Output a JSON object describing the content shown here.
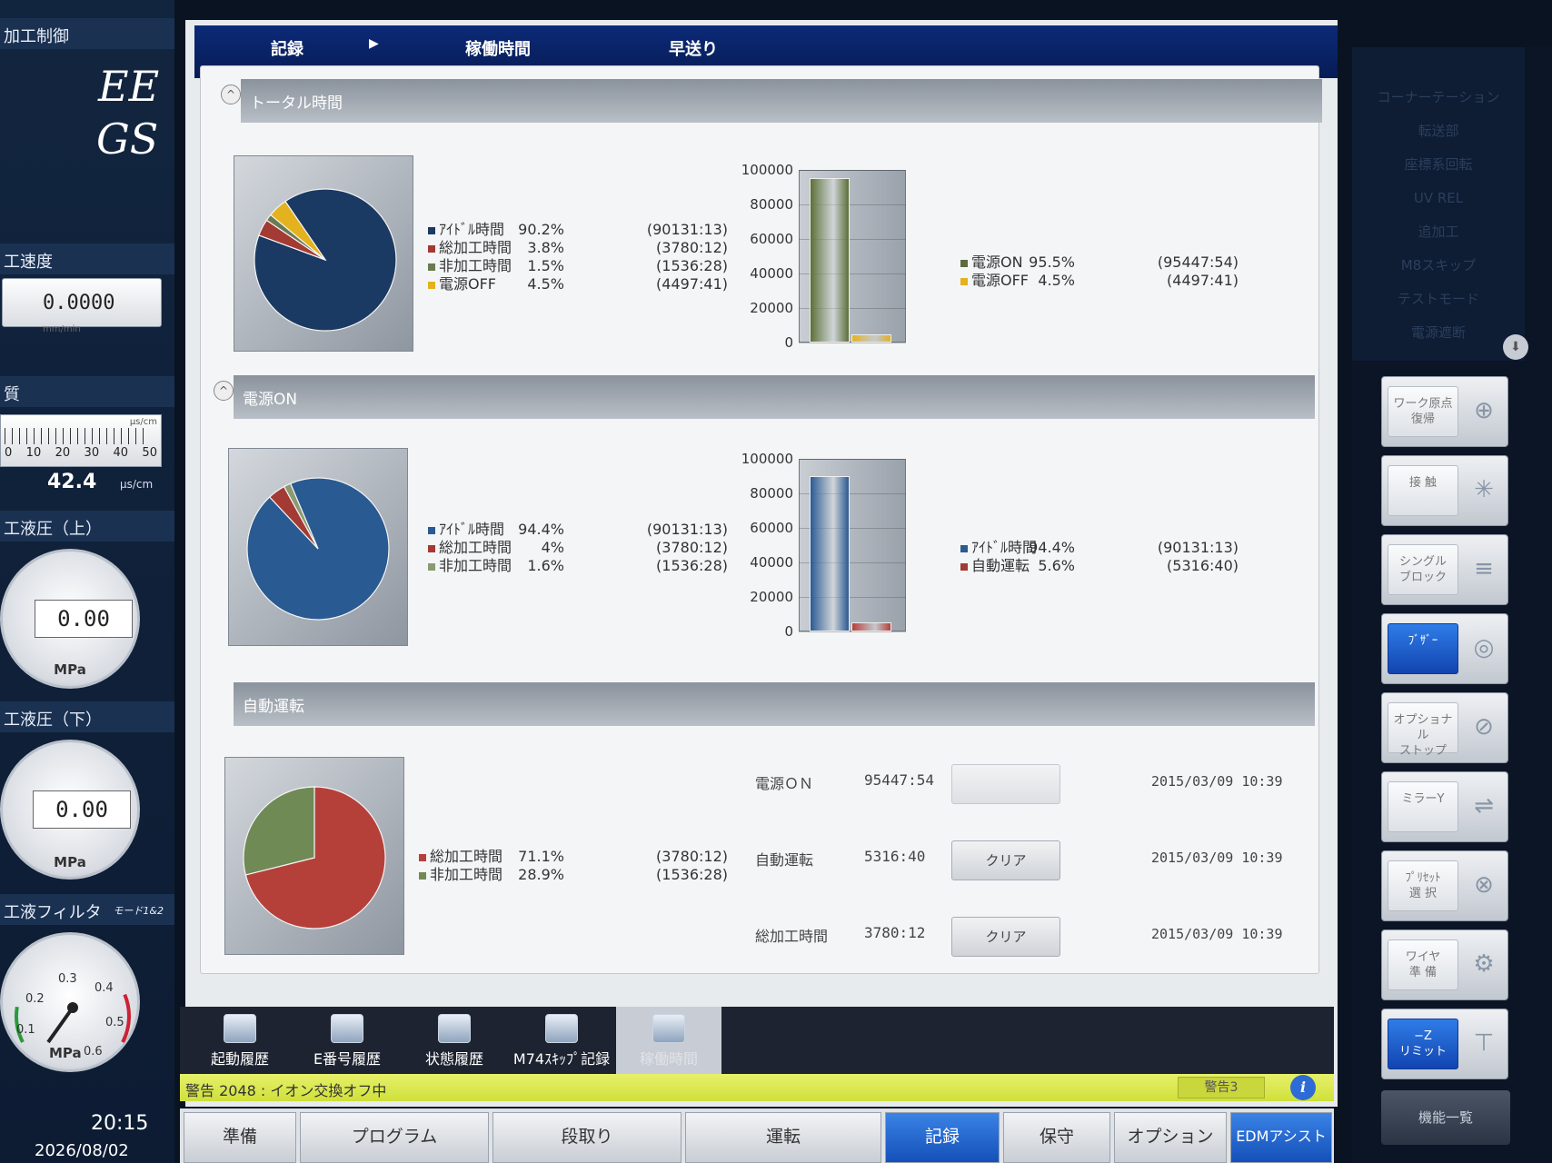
{
  "left": {
    "title": "加工制御",
    "logo_line1": "EE",
    "logo_line2": "GS",
    "speed_label": "工速度",
    "speed_value": "0.0000",
    "speed_unit": "mm/min",
    "quality_label": "質",
    "meter_unit": "μs/cm",
    "meter_ticks": [
      "0",
      "10",
      "20",
      "30",
      "40",
      "50"
    ],
    "meter_value": "42.4",
    "meter_value_unit": "μs/cm",
    "pressure_upper_label": "工液圧（上）",
    "pressure_upper_value": "0.00",
    "pressure_upper_unit": "MPa",
    "pressure_lower_label": "工液圧（下）",
    "pressure_lower_value": "0.00",
    "pressure_lower_unit": "MPa",
    "filter_label": "工液フィルタ",
    "filter_mode": "モード1&2",
    "filter_ticks": [
      "0.1",
      "0.2",
      "0.3",
      "0.4",
      "0.5",
      "0.6"
    ],
    "filter_unit": "MPa",
    "clock_time": "20:15",
    "clock_date": "2026/08/02"
  },
  "tabs": {
    "record": "記録",
    "arrow": "▶",
    "operating": "稼働時間",
    "fast": "早送り"
  },
  "sections": {
    "total": "トータル時間",
    "power_on": "電源ON",
    "auto": "自動運転"
  },
  "total": {
    "legend": [
      {
        "label": "ｱｲﾄﾞﾙ時間",
        "pct": "90.2%",
        "time": "(90131:13)",
        "color": "#1b3a63"
      },
      {
        "label": "総加工時間",
        "pct": "3.8%",
        "time": "(3780:12)",
        "color": "#a33a33"
      },
      {
        "label": "非加工時間",
        "pct": "1.5%",
        "time": "(1536:28)",
        "color": "#6a7a52"
      },
      {
        "label": "電源OFF",
        "pct": "4.5%",
        "time": "(4497:41)",
        "color": "#e3b21e"
      }
    ],
    "bar_legend": [
      {
        "label": "電源ON",
        "pct": "95.5%",
        "time": "(95447:54)",
        "color": "#5c6a3e"
      },
      {
        "label": "電源OFF",
        "pct": "4.5%",
        "time": "(4497:41)",
        "color": "#e3b21e"
      }
    ]
  },
  "power": {
    "legend": [
      {
        "label": "ｱｲﾄﾞﾙ時間",
        "pct": "94.4%",
        "time": "(90131:13)",
        "color": "#2a5a92"
      },
      {
        "label": "総加工時間",
        "pct": "4%",
        "time": "(3780:12)",
        "color": "#a33a33"
      },
      {
        "label": "非加工時間",
        "pct": "1.6%",
        "time": "(1536:28)",
        "color": "#8a9a72"
      }
    ],
    "bar_legend": [
      {
        "label": "ｱｲﾄﾞﾙ時間",
        "pct": "94.4%",
        "time": "(90131:13)",
        "color": "#2a5a92"
      },
      {
        "label": "自動運転",
        "pct": "5.6%",
        "time": "(5316:40)",
        "color": "#a33a33"
      }
    ]
  },
  "auto": {
    "legend": [
      {
        "label": "総加工時間",
        "pct": "71.1%",
        "time": "(3780:12)",
        "color": "#b5403a"
      },
      {
        "label": "非加工時間",
        "pct": "28.9%",
        "time": "(1536:28)",
        "color": "#6f8a55"
      }
    ],
    "rows": [
      {
        "label": "電源ＯＮ",
        "value": "95447:54",
        "button": "",
        "date": "2015/03/09 10:39",
        "disabled": true
      },
      {
        "label": "自動運転",
        "value": "5316:40",
        "button": "クリア",
        "date": "2015/03/09 10:39",
        "disabled": false
      },
      {
        "label": "総加工時間",
        "value": "3780:12",
        "button": "クリア",
        "date": "2015/03/09 10:39",
        "disabled": false
      }
    ]
  },
  "chart_data": [
    {
      "type": "pie",
      "categories": [
        "ｱｲﾄﾞﾙ時間",
        "総加工時間",
        "非加工時間",
        "電源OFF"
      ],
      "values": [
        90.2,
        3.8,
        1.5,
        4.5
      ],
      "colors": [
        "#1b3a63",
        "#a33a33",
        "#6a7a52",
        "#e3b21e"
      ]
    },
    {
      "type": "bar",
      "categories": [
        "電源ON",
        "電源OFF"
      ],
      "values": [
        95447,
        4497
      ],
      "ylim": [
        0,
        100000
      ],
      "yticks": [
        "100000",
        "80000",
        "60000",
        "40000",
        "20000",
        "0"
      ],
      "colors": [
        "#5c7038",
        "#e3b21e"
      ]
    },
    {
      "type": "pie",
      "categories": [
        "ｱｲﾄﾞﾙ時間",
        "総加工時間",
        "非加工時間"
      ],
      "values": [
        94.4,
        4.0,
        1.6
      ],
      "colors": [
        "#2a5a92",
        "#a33a33",
        "#8a9a72"
      ]
    },
    {
      "type": "bar",
      "categories": [
        "ｱｲﾄﾞﾙ時間",
        "自動運転"
      ],
      "values": [
        90131,
        5316
      ],
      "ylim": [
        0,
        100000
      ],
      "yticks": [
        "100000",
        "80000",
        "60000",
        "40000",
        "20000",
        "0"
      ],
      "colors": [
        "#2a5a92",
        "#b5403a"
      ]
    },
    {
      "type": "pie",
      "categories": [
        "総加工時間",
        "非加工時間"
      ],
      "values": [
        71.1,
        28.9
      ],
      "colors": [
        "#b5403a",
        "#6f8a55"
      ]
    }
  ],
  "icon_tabs": [
    "起動履歴",
    "E番号履歴",
    "状態履歴",
    "M74ｽｷｯﾌﾟ記録",
    "稼働時間"
  ],
  "warning": {
    "text": "警告 2048 : イオン交換オフ中",
    "badge": "警告3",
    "info": "i"
  },
  "bottom": [
    "準備",
    "プログラム",
    "段取り",
    "運転",
    "記録",
    "保守",
    "オプション",
    "EDMアシスト"
  ],
  "right": {
    "menu": [
      "",
      "コーナーテーション",
      "転送部",
      "座標系回転",
      "UV REL",
      "追加工",
      "M8スキップ",
      "テストモード",
      "電源遮断"
    ],
    "buttons": [
      {
        "label": "ワーク原点\n復帰",
        "icon": "⊕",
        "blue": false
      },
      {
        "label": "接 触",
        "icon": "✳",
        "blue": false
      },
      {
        "label": "シングル\nブロック",
        "icon": "≡",
        "blue": false
      },
      {
        "label": "ﾌﾞｻﾞｰ",
        "icon": "◎",
        "blue": true
      },
      {
        "label": "オプショナル\nストップ",
        "icon": "⊘",
        "blue": false
      },
      {
        "label": "ミラーY",
        "icon": "⇌",
        "blue": false
      },
      {
        "label": "ﾌﾟﾘｾｯﾄ\n選 択",
        "icon": "⊗",
        "blue": false
      },
      {
        "label": "ワイヤ\n準 備",
        "icon": "⚙",
        "blue": false
      },
      {
        "label": "−Z\nリミット",
        "icon": "⊤",
        "blue": true
      }
    ],
    "func": "機能一覧"
  }
}
